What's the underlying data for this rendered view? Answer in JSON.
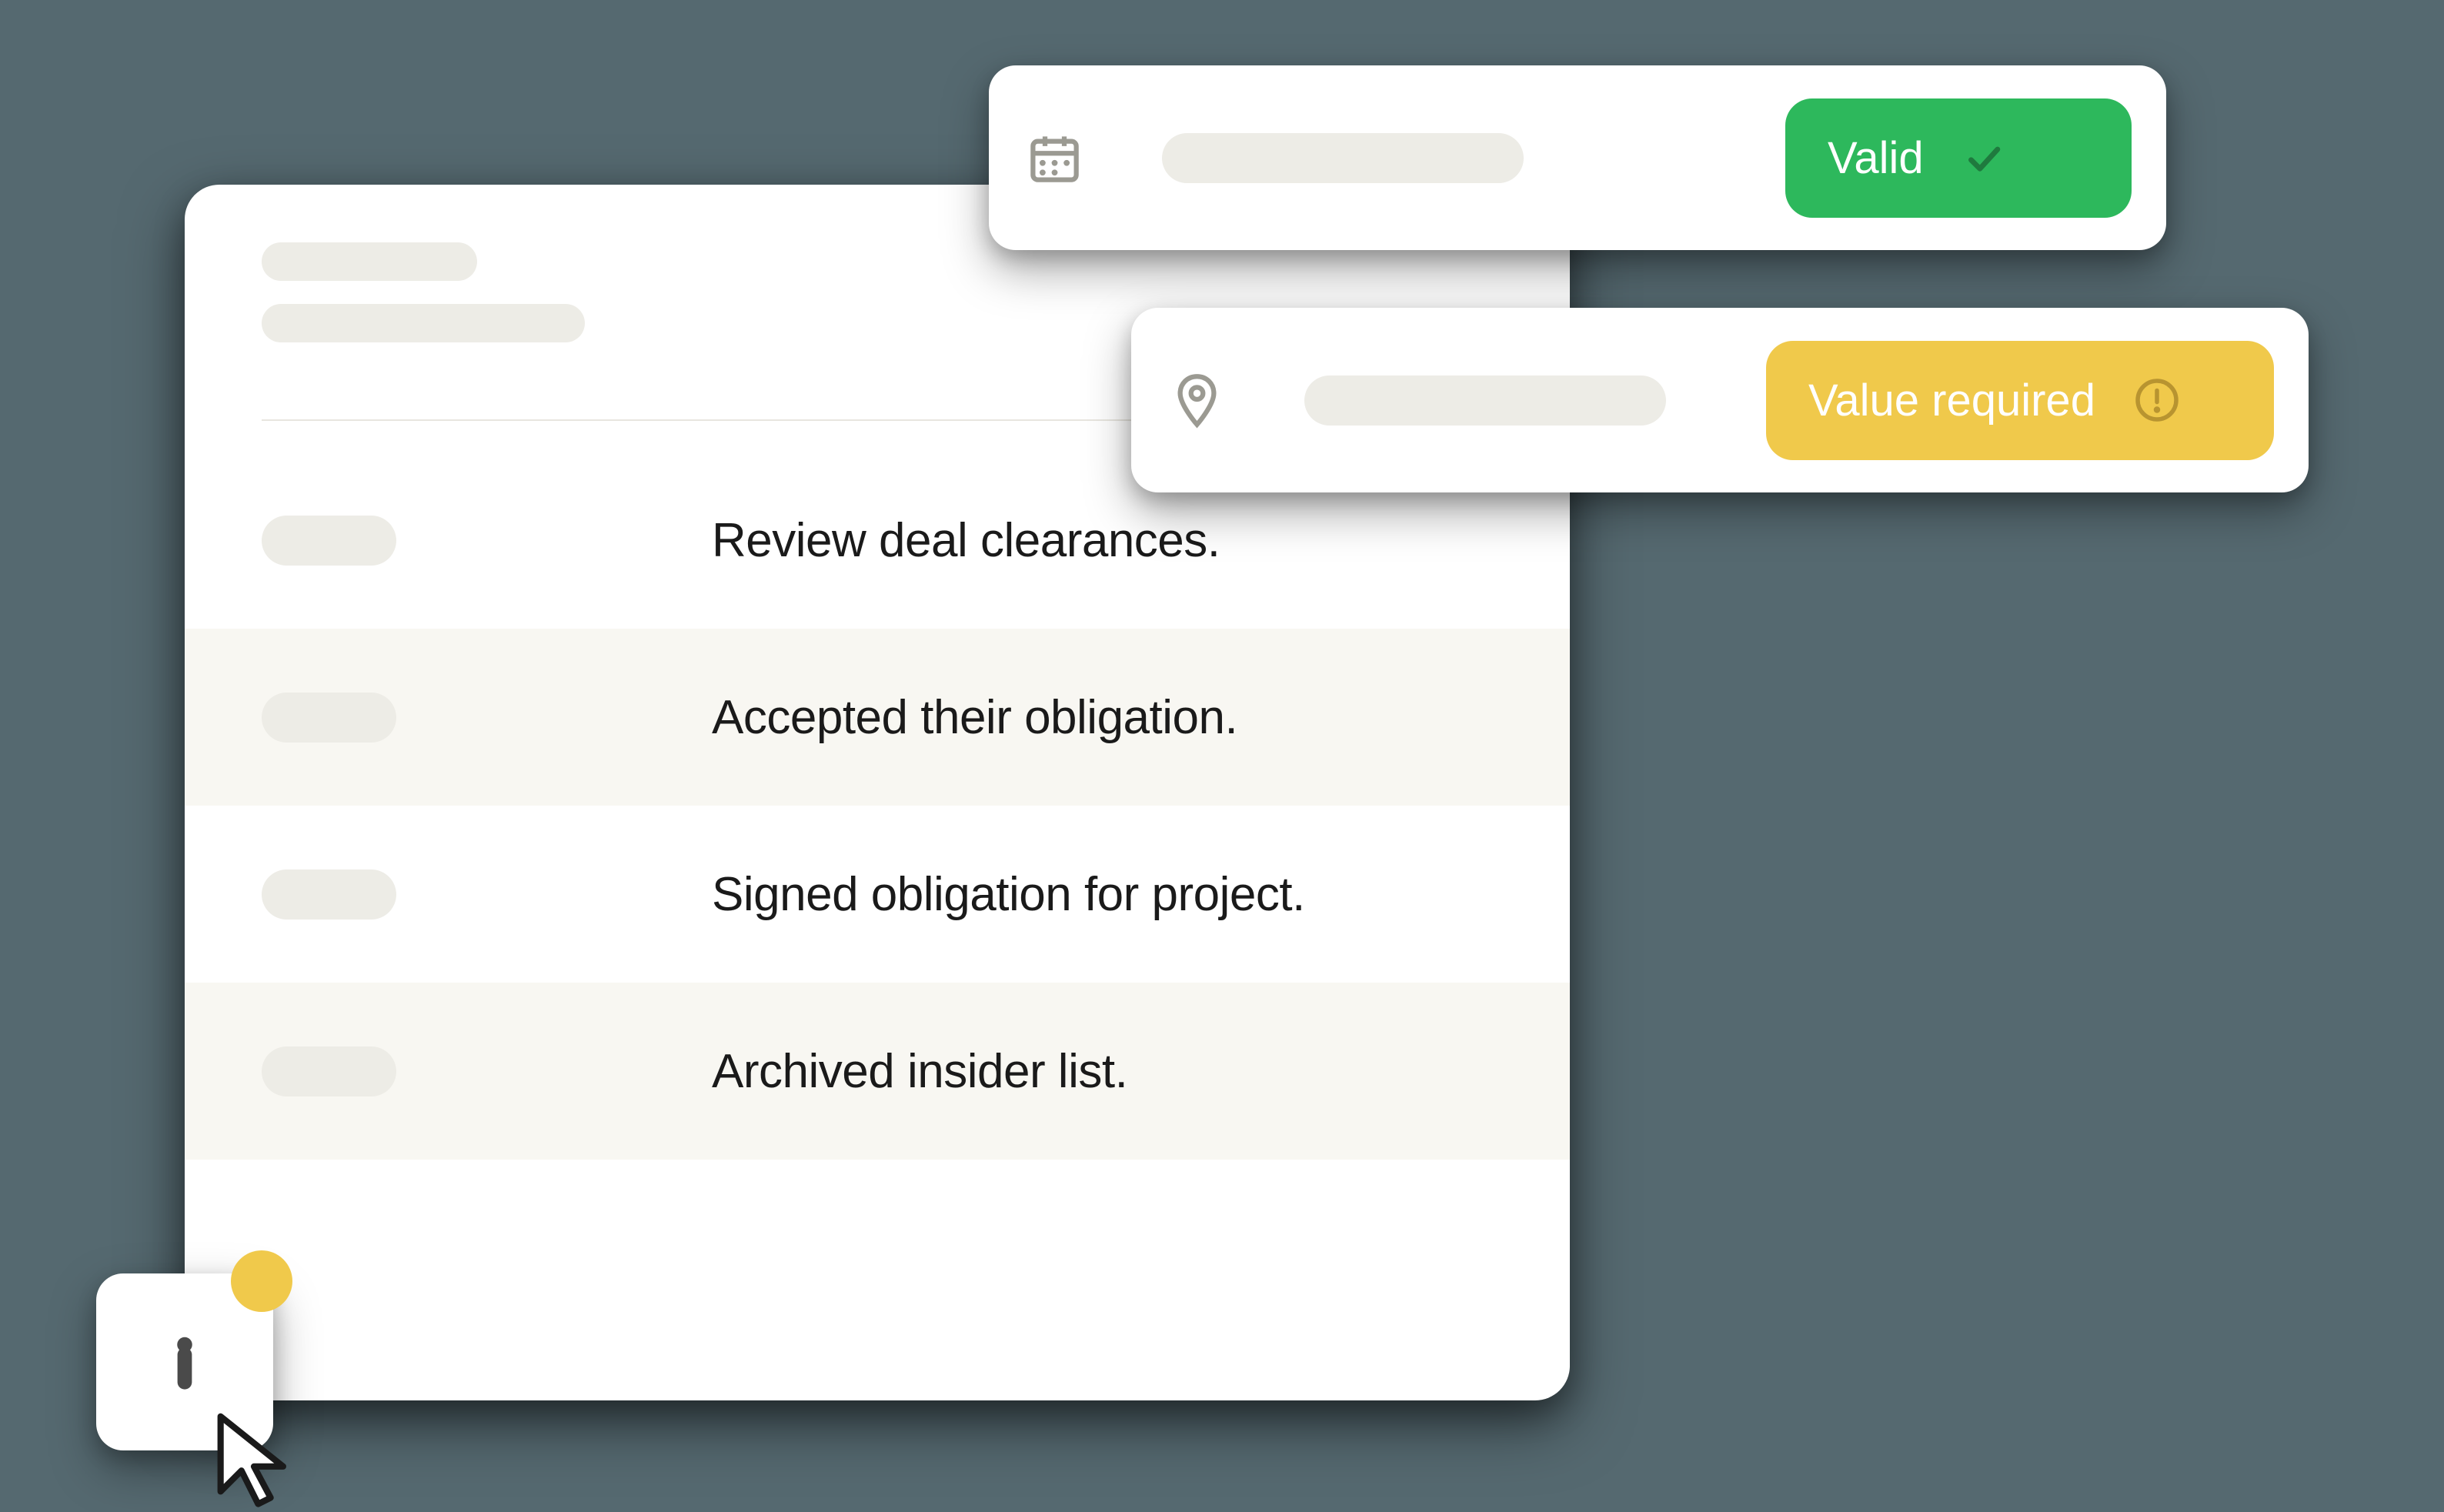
{
  "list": {
    "items": [
      {
        "text": "Review deal clearances."
      },
      {
        "text": "Accepted their obligation."
      },
      {
        "text": "Signed obligation for project."
      },
      {
        "text": "Archived insider list."
      }
    ]
  },
  "floating_cards": {
    "card1": {
      "status_label": "Valid",
      "status_type": "valid"
    },
    "card2": {
      "status_label": "Value required",
      "status_type": "required"
    }
  },
  "colors": {
    "valid_green": "#2db85c",
    "warning_yellow": "#f0c94b",
    "placeholder": "#edece6"
  }
}
